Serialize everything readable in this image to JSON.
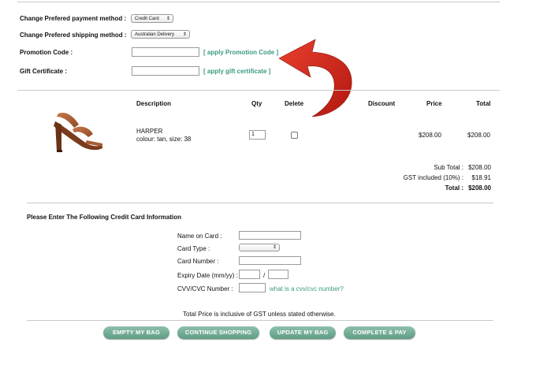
{
  "preferences": {
    "payment_label": "Change Prefered payment method :",
    "payment_value": "Credit Card",
    "shipping_label": "Change Prefered shipping method :",
    "shipping_value": "Australian Delivery",
    "promo_label": "Promotion Code :",
    "promo_link": "[ apply Promotion Code ]",
    "gift_label": "Gift Certificate :",
    "gift_link": "[ apply gift certificate ]"
  },
  "cart": {
    "headers": {
      "description": "Description",
      "qty": "Qty",
      "delete": "Delete",
      "discount": "Discount",
      "price": "Price",
      "total": "Total"
    },
    "item": {
      "name": "HARPER",
      "detail": "colour: tan, size: 38",
      "qty": "1",
      "price": "$208.00",
      "total": "$208.00",
      "image": "tan-heeled-sandal-image"
    },
    "summary": {
      "subtotal_label": "Sub Total :",
      "subtotal_value": "$208.00",
      "gst_label": "GST included (10%) :",
      "gst_value": "$18.91",
      "total_label": "Total :",
      "total_value": "$208.00"
    }
  },
  "credit_card": {
    "heading": "Please Enter The Following Credit Card Information",
    "name_label": "Name on Card :",
    "type_label": "Card Type :",
    "number_label": "Card Number :",
    "expiry_label": "Expiry Date (mm/yy) :",
    "expiry_sep": "/",
    "cvv_label": "CVV/CVC Number :",
    "cvv_link": "what is a cvv/cvc number?"
  },
  "footer": {
    "note": "Total Price is inclusive of GST unless stated otherwise.",
    "buttons": {
      "empty": "EMPTY MY BAG",
      "continue": "CONTINUE SHOPPING",
      "update": "UPDATE MY BAG",
      "complete": "COMPLETE & PAY"
    }
  },
  "colors": {
    "accent_link": "#3a9a82",
    "button": "#6aa892",
    "annotation_arrow": "#d42a1c"
  },
  "annotation": {
    "icon": "red-curved-arrow-icon"
  }
}
